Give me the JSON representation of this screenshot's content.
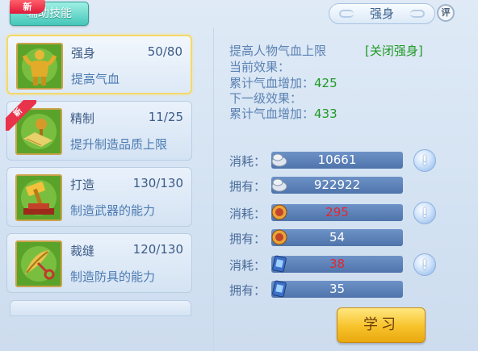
{
  "top_tab": {
    "label": "辅助技能",
    "badge": "新"
  },
  "header": {
    "title": "强身",
    "eval_label": "评"
  },
  "skills": [
    {
      "name": "强身",
      "level": "50/80",
      "desc": "提高气血",
      "new": ""
    },
    {
      "name": "精制",
      "level": "11/25",
      "desc": "提升制造品质上限",
      "new": "新"
    },
    {
      "name": "打造",
      "level": "130/130",
      "desc": "制造武器的能力",
      "new": ""
    },
    {
      "name": "裁缝",
      "level": "120/130",
      "desc": "制造防具的能力",
      "new": ""
    }
  ],
  "detail": {
    "line1": "提高人物气血上限",
    "toggle": "[关闭强身]",
    "current_label": "当前效果：",
    "current_effect_label": "累计气血增加：",
    "current_effect_value": "425",
    "next_label": "下一级效果：",
    "next_effect_label": "累计气血增加：",
    "next_effect_value": "433"
  },
  "resources": [
    {
      "label": "消耗：",
      "value": "10661",
      "icon": "silver-coin-icon",
      "red": false,
      "info": true
    },
    {
      "label": "拥有：",
      "value": "922922",
      "icon": "silver-coin-icon",
      "red": false,
      "info": false
    },
    {
      "label": "消耗：",
      "value": "295",
      "icon": "contribution-badge-icon",
      "red": true,
      "info": true
    },
    {
      "label": "拥有：",
      "value": "54",
      "icon": "contribution-badge-icon",
      "red": false,
      "info": false
    },
    {
      "label": "消耗：",
      "value": "38",
      "icon": "book-card-icon",
      "red": true,
      "info": true
    },
    {
      "label": "拥有：",
      "value": "35",
      "icon": "book-card-icon",
      "red": false,
      "info": false
    }
  ],
  "info_icon_glyph": "!",
  "learn_button": "学习"
}
